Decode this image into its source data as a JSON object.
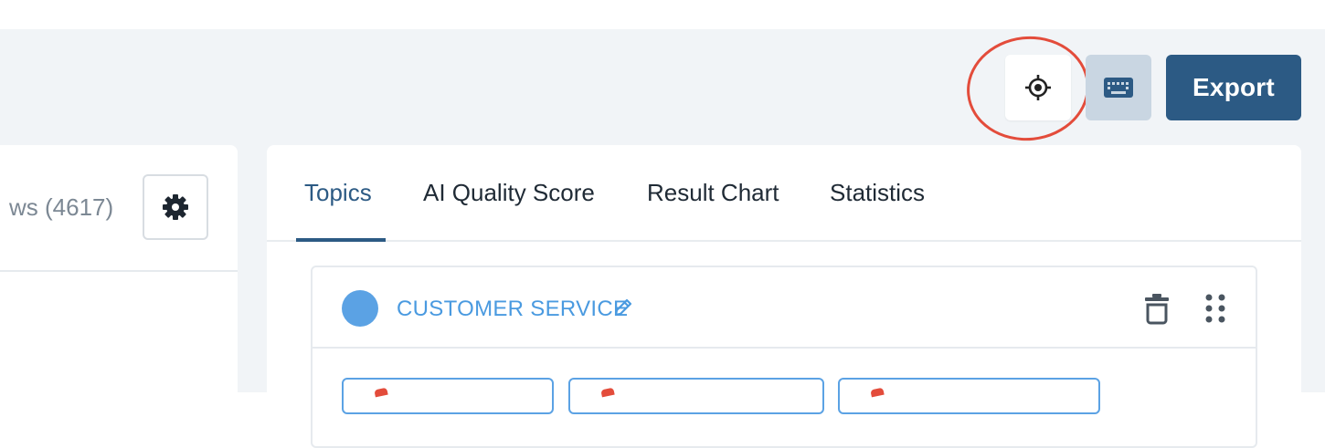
{
  "toolbar": {
    "locate_icon": "crosshair-icon",
    "keyboard_icon": "keyboard-icon",
    "export_label": "Export"
  },
  "left_panel": {
    "title": "ws (4617)",
    "settings_icon": "gear-icon"
  },
  "tabs": [
    {
      "label": "Topics",
      "active": true
    },
    {
      "label": "AI Quality Score",
      "active": false
    },
    {
      "label": "Result Chart",
      "active": false
    },
    {
      "label": "Statistics",
      "active": false
    }
  ],
  "topic": {
    "title": "CUSTOMER SERVICE",
    "color": "#5ba2e4"
  },
  "colors": {
    "accent": "#2c5a84",
    "highlight": "#e34c3b",
    "topic_blue": "#4a9ae0"
  }
}
